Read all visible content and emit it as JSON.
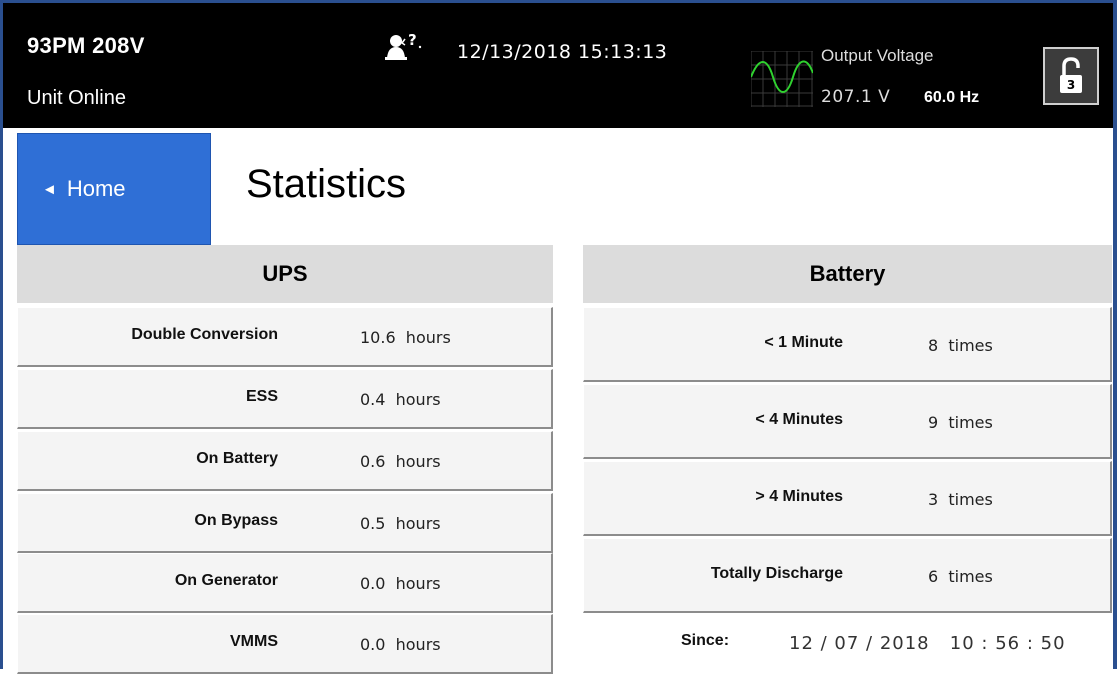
{
  "header": {
    "model": "93PM 208V",
    "status": "Unit Online",
    "datetime": "12/13/2018 15:13:13",
    "output_voltage_label": "Output Voltage",
    "output_voltage_value": "207.1 V",
    "output_frequency": "60.0 Hz",
    "lock_level": "3",
    "help_icon": "operator-help-icon",
    "wave_icon": "sine-wave-icon",
    "lock_icon": "unlocked-padlock-icon"
  },
  "nav": {
    "home_label": "Home",
    "home_arrow": "◄"
  },
  "page": {
    "title": "Statistics"
  },
  "ups": {
    "heading": "UPS",
    "rows": [
      {
        "label": "Double Conversion",
        "value": "10.6  hours"
      },
      {
        "label": "ESS",
        "value": "0.4  hours"
      },
      {
        "label": "On Battery",
        "value": "0.6  hours"
      },
      {
        "label": "On Bypass",
        "value": "0.5  hours"
      },
      {
        "label": "On Generator",
        "value": "0.0  hours"
      },
      {
        "label": "VMMS",
        "value": "0.0  hours"
      }
    ]
  },
  "battery": {
    "heading": "Battery",
    "rows": [
      {
        "label": "< 1 Minute",
        "value": "8  times"
      },
      {
        "label": "< 4 Minutes",
        "value": "9  times"
      },
      {
        "label": "> 4 Minutes",
        "value": "3  times"
      },
      {
        "label": "Totally Discharge",
        "value": "6  times"
      }
    ],
    "since_label": "Since:",
    "since_value": "12 / 07 / 2018   10 : 56 : 50"
  },
  "colors": {
    "header_bg": "#000000",
    "home_button": "#2f6fd6",
    "panel_header": "#dcdcdc",
    "row_bg": "#f4f4f4",
    "frame": "#2a4f8f",
    "wave": "#2fd12f"
  }
}
